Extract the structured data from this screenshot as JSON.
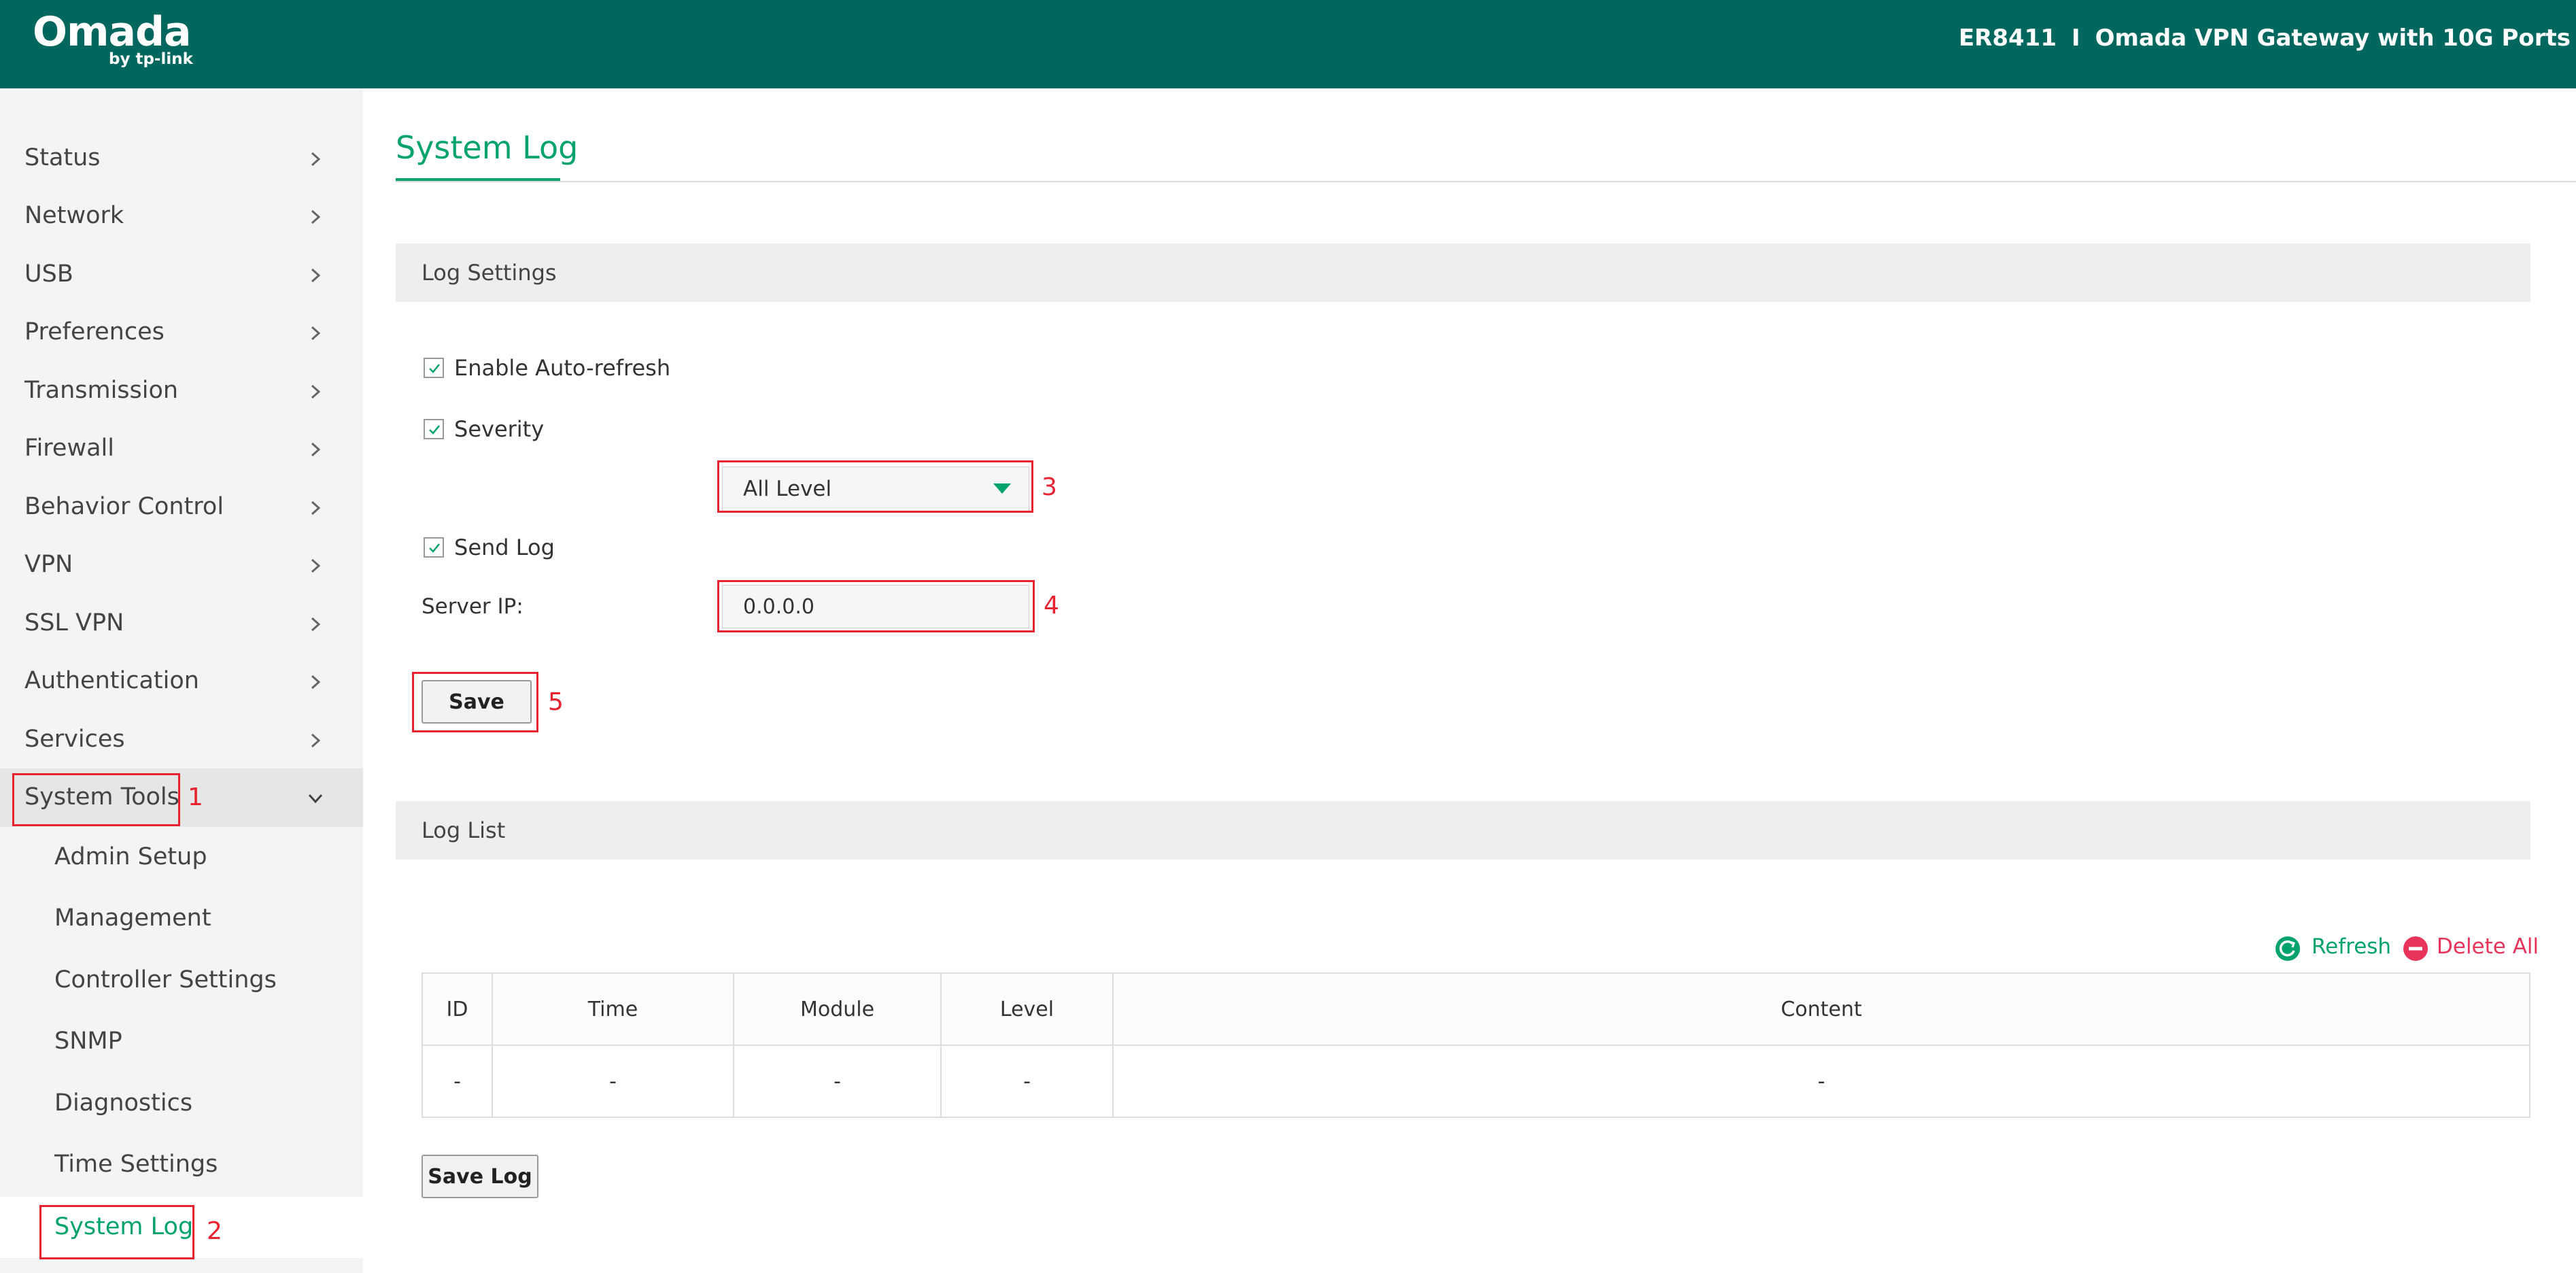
{
  "header": {
    "logo_main": "Omada",
    "logo_sub": "by tp-link",
    "model": "ER8411",
    "separator": "I",
    "product_name": "Omada VPN Gateway with 10G Ports"
  },
  "sidebar": {
    "items": [
      {
        "label": "Status"
      },
      {
        "label": "Network"
      },
      {
        "label": "USB"
      },
      {
        "label": "Preferences"
      },
      {
        "label": "Transmission"
      },
      {
        "label": "Firewall"
      },
      {
        "label": "Behavior Control"
      },
      {
        "label": "VPN"
      },
      {
        "label": "SSL VPN"
      },
      {
        "label": "Authentication"
      },
      {
        "label": "Services"
      },
      {
        "label": "System Tools"
      }
    ],
    "subitems": [
      {
        "label": "Admin Setup"
      },
      {
        "label": "Management"
      },
      {
        "label": "Controller Settings"
      },
      {
        "label": "SNMP"
      },
      {
        "label": "Diagnostics"
      },
      {
        "label": "Time Settings"
      },
      {
        "label": "System Log"
      }
    ]
  },
  "page": {
    "title": "System Log"
  },
  "log_settings": {
    "section_title": "Log Settings",
    "auto_refresh_label": "Enable Auto-refresh",
    "severity_label": "Severity",
    "severity_value": "All Level",
    "send_log_label": "Send Log",
    "server_ip_label": "Server IP:",
    "server_ip_value": "0.0.0.0",
    "save_label": "Save"
  },
  "log_list": {
    "section_title": "Log List",
    "refresh_label": "Refresh",
    "delete_all_label": "Delete All",
    "columns": [
      "ID",
      "Time",
      "Module",
      "Level",
      "Content"
    ],
    "rows": [
      [
        "-",
        "-",
        "-",
        "-",
        "-"
      ]
    ],
    "save_log_label": "Save Log"
  },
  "annotations": [
    "1",
    "2",
    "3",
    "4",
    "5"
  ],
  "colors": {
    "header_bg": "#00675f",
    "accent_green": "#00a36c",
    "annotation_red": "#e8222f",
    "delete_red": "#e8345a"
  },
  "icons": {
    "nav_chevron": "chevron-right-icon",
    "nav_expanded": "chevron-down-icon",
    "checkbox": "checkmark-icon",
    "refresh": "refresh-icon",
    "delete": "minus-circle-icon"
  }
}
